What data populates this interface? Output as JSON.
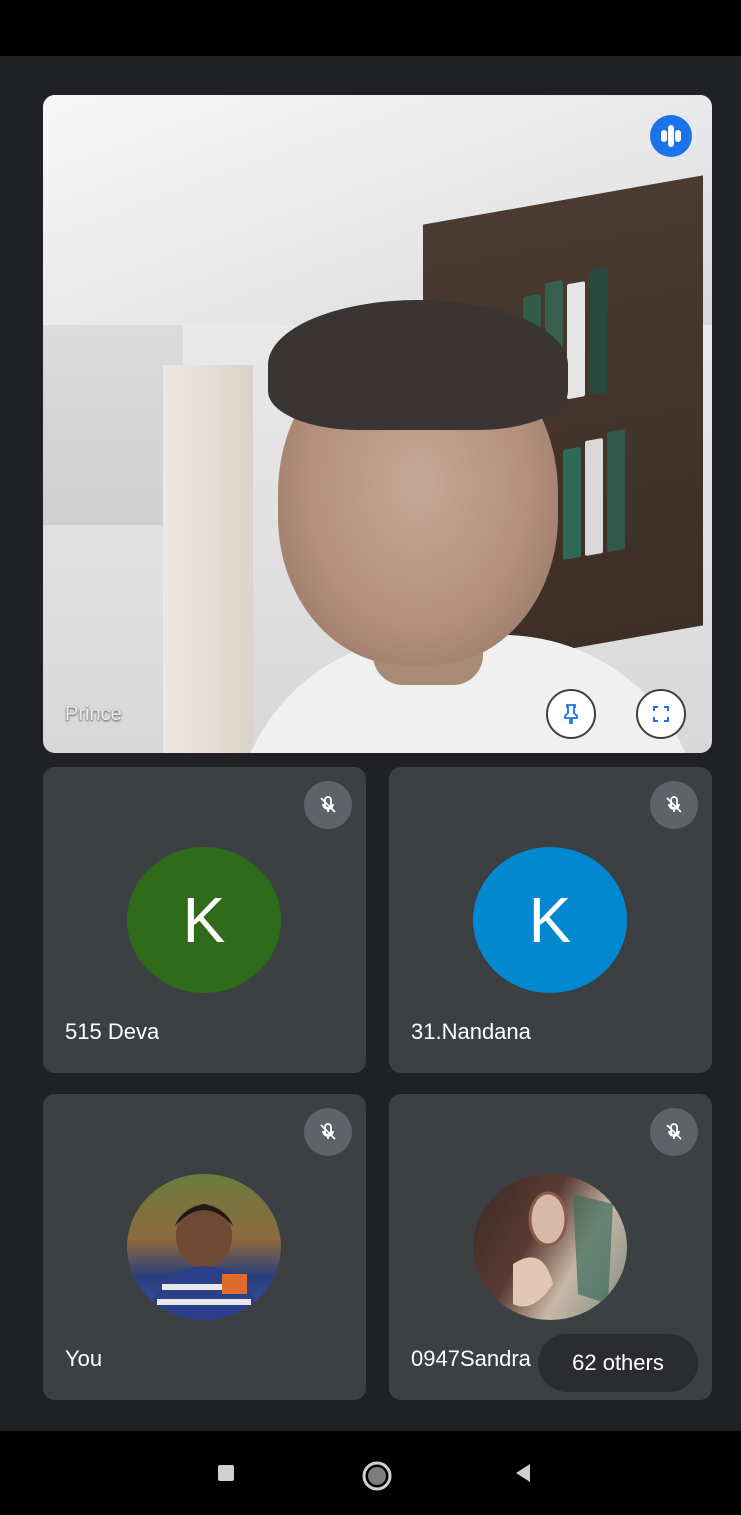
{
  "main_speaker": {
    "name": "Prince",
    "voice_indicator_icon": "audio-level-icon",
    "pin_icon": "pin-icon",
    "fullscreen_icon": "fullscreen-icon"
  },
  "participants": [
    {
      "name": "515 Deva",
      "initial": "K",
      "avatar_color": "#2e6b1b",
      "muted": true
    },
    {
      "name": "31.Nandana",
      "initial": "K",
      "avatar_color": "#0288d1",
      "muted": true
    },
    {
      "name": "You",
      "initial": "",
      "avatar_color": "",
      "muted": true,
      "avatar_type": "photo"
    },
    {
      "name": "0947Sandra",
      "initial": "",
      "avatar_color": "",
      "muted": true,
      "avatar_type": "photo"
    }
  ],
  "others_pill": "62 others",
  "nav": {
    "recents_icon": "square-recents-icon",
    "home_icon": "circle-home-icon",
    "back_icon": "triangle-back-icon"
  },
  "colors": {
    "background": "#202124",
    "tile": "#3c4043",
    "accent": "#1a73e8",
    "mute_badge": "#5f6368"
  }
}
